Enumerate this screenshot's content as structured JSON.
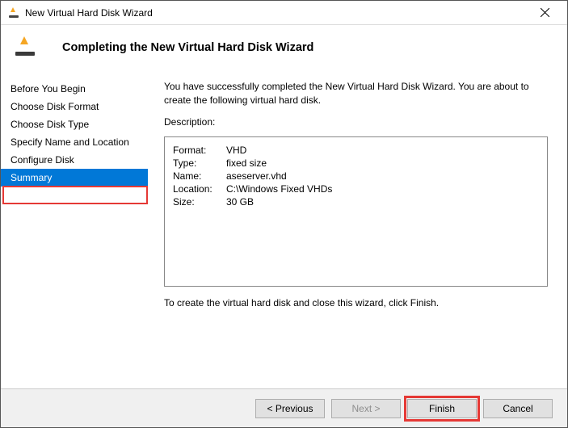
{
  "window": {
    "title": "New Virtual Hard Disk Wizard"
  },
  "header": {
    "heading": "Completing the New Virtual Hard Disk Wizard"
  },
  "nav": {
    "items": [
      {
        "label": "Before You Begin"
      },
      {
        "label": "Choose Disk Format"
      },
      {
        "label": "Choose Disk Type"
      },
      {
        "label": "Specify Name and Location"
      },
      {
        "label": "Configure Disk"
      },
      {
        "label": "Summary"
      }
    ]
  },
  "main": {
    "intro": "You have successfully completed the New Virtual Hard Disk Wizard. You are about to create the following virtual hard disk.",
    "desc_label": "Description:",
    "summary": {
      "format_k": "Format:",
      "format_v": "VHD",
      "type_k": "Type:",
      "type_v": "fixed size",
      "name_k": "Name:",
      "name_v": "aseserver.vhd",
      "location_k": "Location:",
      "location_v": "C:\\Windows Fixed VHDs",
      "size_k": "Size:",
      "size_v": "30 GB"
    },
    "closing": "To create the virtual hard disk and close this wizard, click Finish."
  },
  "footer": {
    "previous": "< Previous",
    "next": "Next >",
    "finish": "Finish",
    "cancel": "Cancel"
  }
}
